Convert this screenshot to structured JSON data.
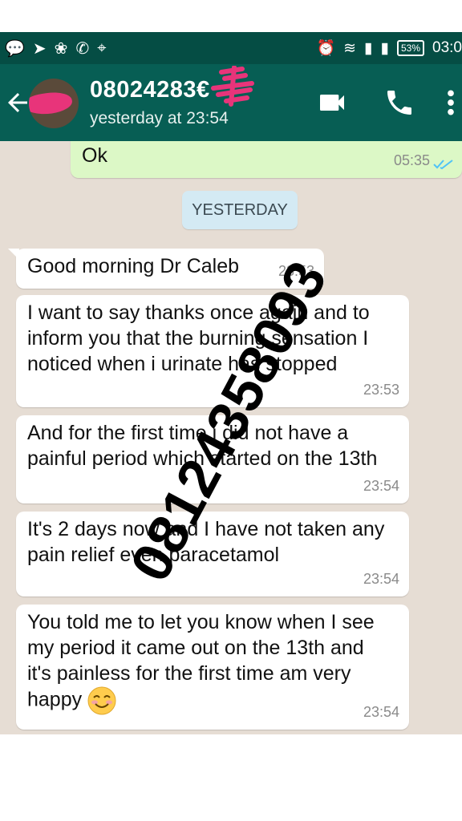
{
  "status_bar": {
    "battery": "53%",
    "time": "03:0"
  },
  "header": {
    "contact": "08024283€",
    "last_seen": "yesterday at 23:54"
  },
  "messages": [
    {
      "text": "Ok",
      "time": "05:35",
      "outgoing": true
    },
    {
      "date_separator": "YESTERDAY"
    },
    {
      "text": "Good morning Dr Caleb",
      "time": "23:53"
    },
    {
      "text": "I want to say thanks once again and to inform you that the burning sensation I noticed when i urinate has stopped",
      "time": "23:53"
    },
    {
      "text": "And for the first time i did not have a painful period which started on the 13th",
      "time": "23:54"
    },
    {
      "text": "It's 2 days now and I have not taken any pain relief even paracetamol",
      "time": "23:54"
    },
    {
      "text": "You told me to let you know when I see my period it came out on the 13th and it's painless for the first time am very happy",
      "time": "23:54"
    }
  ],
  "watermark": "08124358093",
  "colors": {
    "header": "#075e54",
    "status_bar": "#054d44",
    "chat_bg": "#e6ddd4",
    "outgoing": "#dcf8c6",
    "read_ticks": "#4fc3f7"
  },
  "icons": [
    "back-arrow-icon",
    "video-call-icon",
    "phone-icon",
    "more-vert-icon",
    "smiling-emoji-icon"
  ]
}
